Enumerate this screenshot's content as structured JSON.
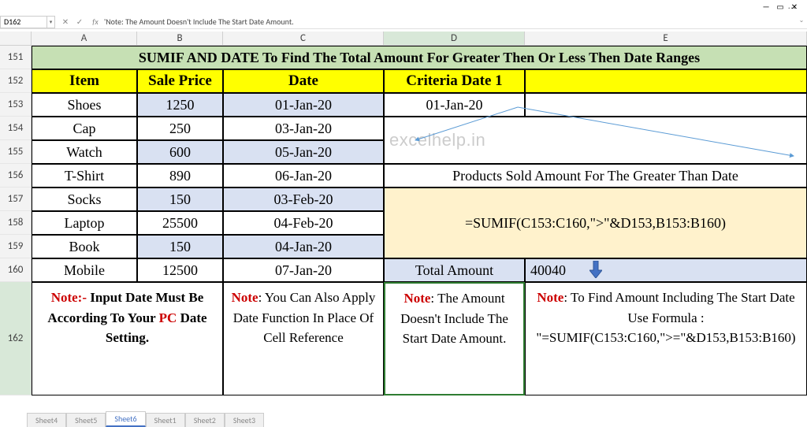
{
  "window": {
    "dots": "···"
  },
  "namebox": {
    "ref": "D162",
    "fx": "fx",
    "formula": "'Note: The Amount Doesn't Include The Start Date Amount."
  },
  "columns": [
    "A",
    "B",
    "C",
    "D",
    "E"
  ],
  "rows": [
    "151",
    "152",
    "153",
    "154",
    "155",
    "156",
    "157",
    "158",
    "159",
    "160",
    "162"
  ],
  "title": "SUMIF AND DATE To Find The Total Amount For Greater Then Or Less Then Date Ranges",
  "headers": {
    "item": "Item",
    "price": "Sale Price",
    "date": "Date",
    "crit": "Criteria Date 1"
  },
  "data": [
    {
      "item": "Shoes",
      "price": "1250",
      "date": "01-Jan-20",
      "crit": "01-Jan-20",
      "shade": "blue"
    },
    {
      "item": "Cap",
      "price": "250",
      "date": "03-Jan-20",
      "shade": "white"
    },
    {
      "item": "Watch",
      "price": "600",
      "date": "05-Jan-20",
      "shade": "blue"
    },
    {
      "item": "T-Shirt",
      "price": "890",
      "date": "06-Jan-20",
      "shade": "white"
    },
    {
      "item": "Socks",
      "price": "150",
      "date": "03-Feb-20",
      "shade": "blue"
    },
    {
      "item": "Laptop",
      "price": "25500",
      "date": "04-Feb-20",
      "shade": "white"
    },
    {
      "item": "Book",
      "price": "150",
      "date": "04-Jan-20",
      "shade": "blue"
    },
    {
      "item": "Mobile",
      "price": "12500",
      "date": "07-Jan-20",
      "shade": "white"
    }
  ],
  "watermark": "excelhelp.in",
  "desc": "Products Sold Amount For The Greater Than Date",
  "formula_text": "=SUMIF(C153:C160,\">\"&D153,B153:B160)",
  "total": {
    "label": "Total Amount",
    "value": "40040"
  },
  "notes": {
    "n1_pre": "Note:- ",
    "n1_mid": "Input Date Must Be According To Your ",
    "n1_pc": "PC",
    "n1_end": " Date Setting.",
    "n2_pre": "Note",
    "n2_body": ": You Can Also Apply Date Function In Place Of Cell Reference",
    "n3_pre": "Note",
    "n3_body": ": The Amount Doesn't Include The Start Date Amount.",
    "n4_pre": "Note",
    "n4_body": ": To Find Amount Including The Start Date Use Formula : \"=SUMIF(C153:C160,\">=\"&D153,B153:B160)"
  },
  "tabs": [
    "Sheet4",
    "Sheet5",
    "Sheet6",
    "Sheet1",
    "Sheet2",
    "Sheet3"
  ],
  "active_tab": 2
}
